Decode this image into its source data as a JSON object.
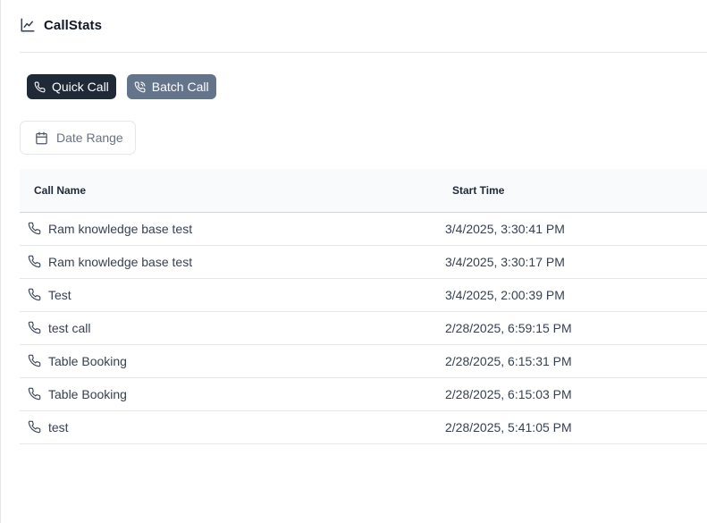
{
  "header": {
    "title": "CallStats",
    "icon": "line-chart-icon"
  },
  "actions": {
    "quick_call": {
      "label": "Quick Call",
      "icon": "phone-icon"
    },
    "batch_call": {
      "label": "Batch Call",
      "icon": "phone-call-icon"
    }
  },
  "filters": {
    "date_range": {
      "label": "Date Range",
      "icon": "calendar-icon"
    }
  },
  "table": {
    "columns": [
      "Call Name",
      "Start Time"
    ],
    "rows": [
      {
        "name": "Ram knowledge base test",
        "start_time": "3/4/2025, 3:30:41 PM"
      },
      {
        "name": "Ram knowledge base test",
        "start_time": "3/4/2025, 3:30:17 PM"
      },
      {
        "name": "Test",
        "start_time": "3/4/2025, 2:00:39 PM"
      },
      {
        "name": "test call",
        "start_time": "2/28/2025, 6:59:15 PM"
      },
      {
        "name": "Table Booking",
        "start_time": "2/28/2025, 6:15:31 PM"
      },
      {
        "name": "Table Booking",
        "start_time": "2/28/2025, 6:15:03 PM"
      },
      {
        "name": "test",
        "start_time": "2/28/2025, 5:41:05 PM"
      }
    ]
  },
  "colors": {
    "primary_button": "#1f2937",
    "secondary_button": "#64748b",
    "header_bg": "#f8fafc",
    "border": "#e5e7eb"
  }
}
